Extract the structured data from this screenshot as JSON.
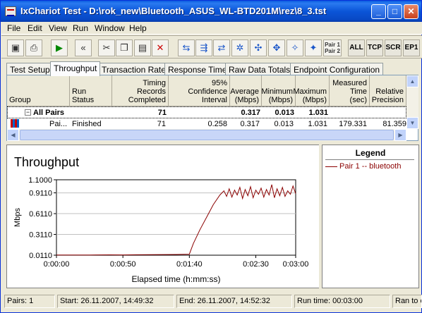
{
  "window": {
    "title": "IxChariot Test - D:\\rok_new\\Bluetooth_ASUS_WL-BTD201M\\rez\\8_3.tst",
    "min": "_",
    "max": "□",
    "close": "✕"
  },
  "menu": [
    "File",
    "Edit",
    "View",
    "Run",
    "Window",
    "Help"
  ],
  "toolbar": {
    "pair": "Pair 1\nPair 2",
    "all": "ALL",
    "tcp": "TCP",
    "scr": "SCR",
    "ep1": "EP1"
  },
  "tabs": [
    "Test Setup",
    "Throughput",
    "Transaction Rate",
    "Response Time",
    "Raw Data Totals",
    "Endpoint Configuration"
  ],
  "grid": {
    "headers": [
      "Group",
      "Run Status",
      "Timing Records Completed",
      "95% Confidence Interval",
      "Average (Mbps)",
      "Minimum (Mbps)",
      "Maximum (Mbps)",
      "Measured Time (sec)",
      "Relative Precision"
    ],
    "allpairs": {
      "group": "All Pairs",
      "records": "71",
      "average": "0.317",
      "minimum": "0.013",
      "maximum": "1.031"
    },
    "pair": {
      "group": "Pai...",
      "status": "Finished",
      "records": "71",
      "ci": "0.258",
      "average": "0.317",
      "minimum": "0.013",
      "maximum": "1.031",
      "time": "179.331",
      "precision": "81.359"
    }
  },
  "chart_data": {
    "type": "line",
    "title": "Throughput",
    "xlabel": "Elapsed time (h:mm:ss)",
    "ylabel": "Mbps",
    "yticks": [
      "1.1000",
      "0.9110",
      "0.6110",
      "0.3110",
      "0.0110"
    ],
    "xticks": [
      "0:00:00",
      "0:00:50",
      "0:01:40",
      "0:02:30",
      "0:03:00"
    ],
    "ylim": [
      0.011,
      1.1
    ],
    "xlim_sec": [
      0,
      180
    ],
    "series": [
      {
        "name": "Pair 1 -- bluetooth",
        "color": "#8b0000",
        "x": [
          0,
          10,
          20,
          30,
          40,
          50,
          60,
          70,
          80,
          90,
          100,
          103,
          108,
          113,
          118,
          123,
          126,
          128,
          130,
          132,
          134,
          136,
          138,
          140,
          142,
          144,
          146,
          148,
          150,
          152,
          154,
          156,
          158,
          160,
          162,
          164,
          166,
          168,
          170,
          172,
          174,
          176,
          178,
          180
        ],
        "y": [
          0.013,
          0.014,
          0.013,
          0.015,
          0.016,
          0.015,
          0.017,
          0.018,
          0.02,
          0.021,
          0.025,
          0.18,
          0.38,
          0.56,
          0.74,
          0.88,
          0.94,
          0.86,
          0.97,
          0.85,
          0.95,
          0.88,
          0.99,
          0.83,
          0.96,
          0.87,
          1.0,
          0.84,
          0.95,
          0.89,
          0.98,
          0.85,
          0.96,
          0.88,
          1.03,
          0.84,
          0.97,
          0.87,
          0.99,
          0.86,
          0.94,
          0.89,
          1.01,
          0.9
        ]
      }
    ]
  },
  "legend": {
    "title": "Legend"
  },
  "status": {
    "pairs": "Pairs: 1",
    "start": "Start: 26.11.2007, 14:49:32",
    "end": "End: 26.11.2007, 14:52:32",
    "runtime": "Run time: 00:03:00",
    "ran": "Ran to completion"
  }
}
